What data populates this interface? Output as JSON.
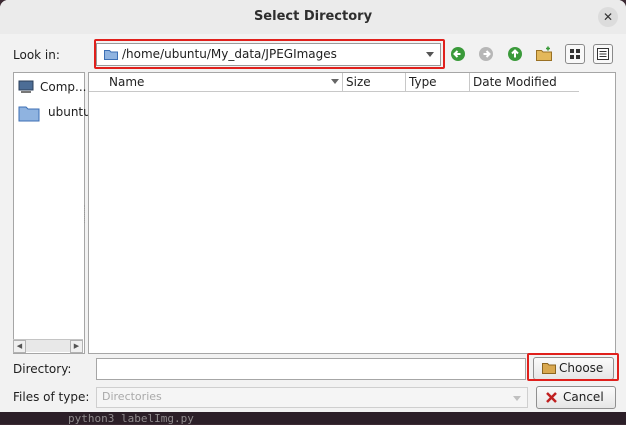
{
  "dialog": {
    "title": "Select Directory"
  },
  "look_in": {
    "label": "Look in:",
    "path": "/home/ubuntu/My_data/JPEGImages"
  },
  "toolbar": {
    "icons": [
      "back-icon",
      "forward-icon",
      "up-icon",
      "new-folder-icon",
      "list-view-icon",
      "details-view-icon"
    ]
  },
  "sidebar": {
    "items": [
      {
        "label": "Comp...",
        "icon": "computer-icon"
      },
      {
        "label": "ubuntu",
        "icon": "folder-icon"
      }
    ]
  },
  "file_table": {
    "columns": [
      "Name",
      "Size",
      "Type",
      "Date Modified"
    ],
    "rows": []
  },
  "directory": {
    "label": "Directory:",
    "value": ""
  },
  "files_of_type": {
    "label": "Files of type:",
    "value": "Directories"
  },
  "buttons": {
    "choose": "Choose",
    "cancel": "Cancel"
  },
  "background": {
    "terminal_text": "python3 labelImg.py"
  },
  "colors": {
    "highlight": "#e0201c",
    "dialog_bg": "#f2f2f2",
    "terminal_bg": "#2c1f28"
  }
}
